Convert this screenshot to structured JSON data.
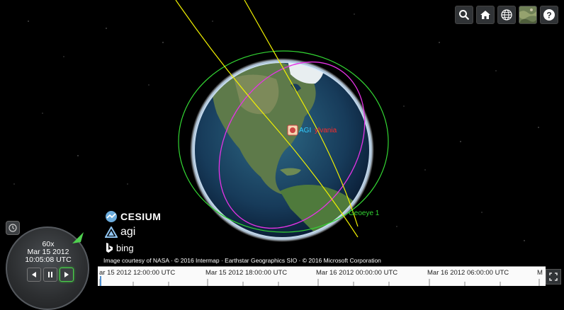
{
  "toolbar": {
    "buttons": [
      {
        "name": "geocoder-search-icon"
      },
      {
        "name": "home-icon"
      },
      {
        "name": "scene-mode-globe-icon"
      },
      {
        "name": "base-layer-picker-icon"
      },
      {
        "name": "help-icon"
      }
    ]
  },
  "labels": {
    "ground_station": "AGI",
    "ground_station_suffix": "ylvania",
    "satellite": "Geoeye 1"
  },
  "credits": {
    "cesium": "CESIUM",
    "agi": "agi",
    "bing": "bing",
    "text": "Image courtesy of NASA · © 2016 Intermap · Earthstar Geographics SIO · © 2016 Microsoft Corporation"
  },
  "animation": {
    "speed": "60x",
    "date": "Mar 15 2012",
    "time": "10:05:08 UTC",
    "colors": {
      "play_active": "#4fd14f"
    }
  },
  "timeline": {
    "labels": [
      "ar 15 2012 12:00:00 UTC",
      "Mar 15 2012 18:00:00 UTC",
      "Mar 16 2012 00:00:00 UTC",
      "Mar 16 2012 06:00:00 UTC",
      "M"
    ]
  },
  "colors": {
    "orbit_yellow": "#f2f200",
    "orbit_magenta": "#e633e6",
    "orbit_green": "#33d633",
    "label_red": "#ff2a2a",
    "label_cyan": "#33ccff"
  }
}
